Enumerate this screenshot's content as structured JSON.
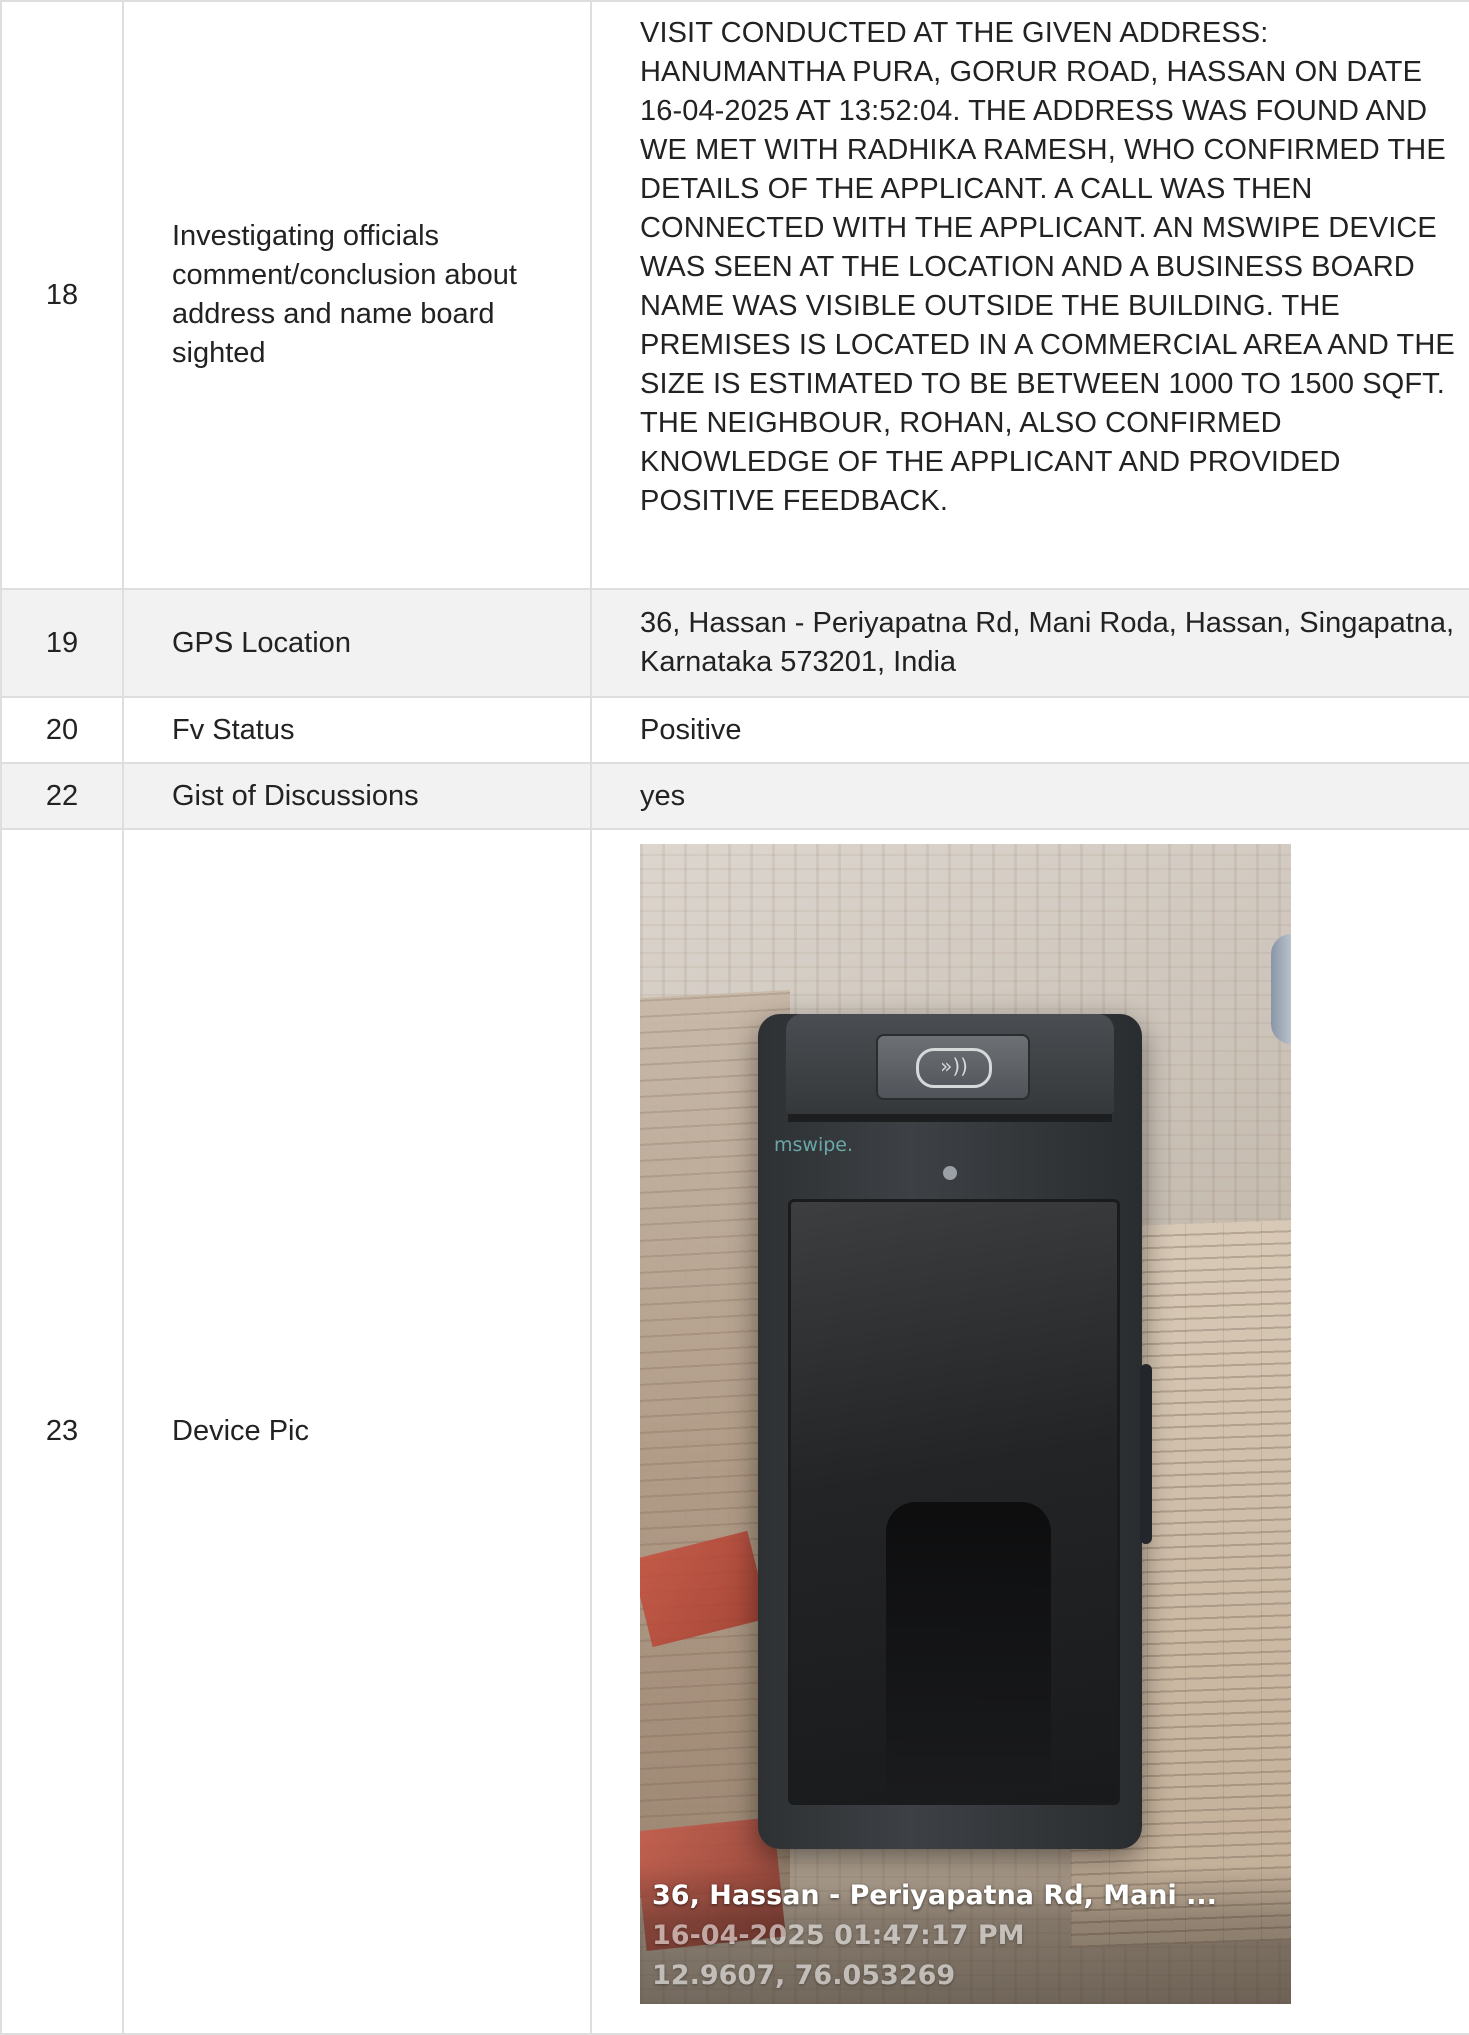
{
  "rows": [
    {
      "num": "18",
      "label": "Investigating officials comment/conclusion about address and name board sighted",
      "value": "VISIT CONDUCTED AT THE GIVEN ADDRESS: HANUMANTHA PURA, GORUR ROAD, HASSAN ON DATE 16-04-2025 AT 13:52:04. THE ADDRESS WAS FOUND AND WE MET WITH RADHIKA RAMESH, WHO CONFIRMED THE DETAILS OF THE APPLICANT. A CALL WAS THEN CONNECTED WITH THE APPLICANT. AN MSWIPE DEVICE WAS SEEN AT THE LOCATION AND A BUSINESS BOARD NAME WAS VISIBLE OUTSIDE THE BUILDING. THE PREMISES IS LOCATED IN A COMMERCIAL AREA AND THE SIZE IS ESTIMATED TO BE BETWEEN 1000 TO 1500 SQFT. THE NEIGHBOUR, ROHAN, ALSO CONFIRMED KNOWLEDGE OF THE APPLICANT AND PROVIDED POSITIVE FEEDBACK."
    },
    {
      "num": "19",
      "label": "GPS Location",
      "value": "36, Hassan - Periyapatna Rd, Mani Roda, Hassan, Singapatna, Karnataka 573201, India"
    },
    {
      "num": "20",
      "label": "Fv Status",
      "value": "Positive"
    },
    {
      "num": "22",
      "label": "Gist of Discussions",
      "value": "yes"
    },
    {
      "num": "23",
      "label": "Device Pic",
      "photo": {
        "brand": "mswipe.",
        "nfc_symbol": "»))",
        "overlay": {
          "address": "36, Hassan - Periyapatna Rd, Mani ...",
          "datetime": "16-04-2025 01:47:17 PM",
          "coords": "12.9607, 76.053269"
        }
      }
    }
  ]
}
